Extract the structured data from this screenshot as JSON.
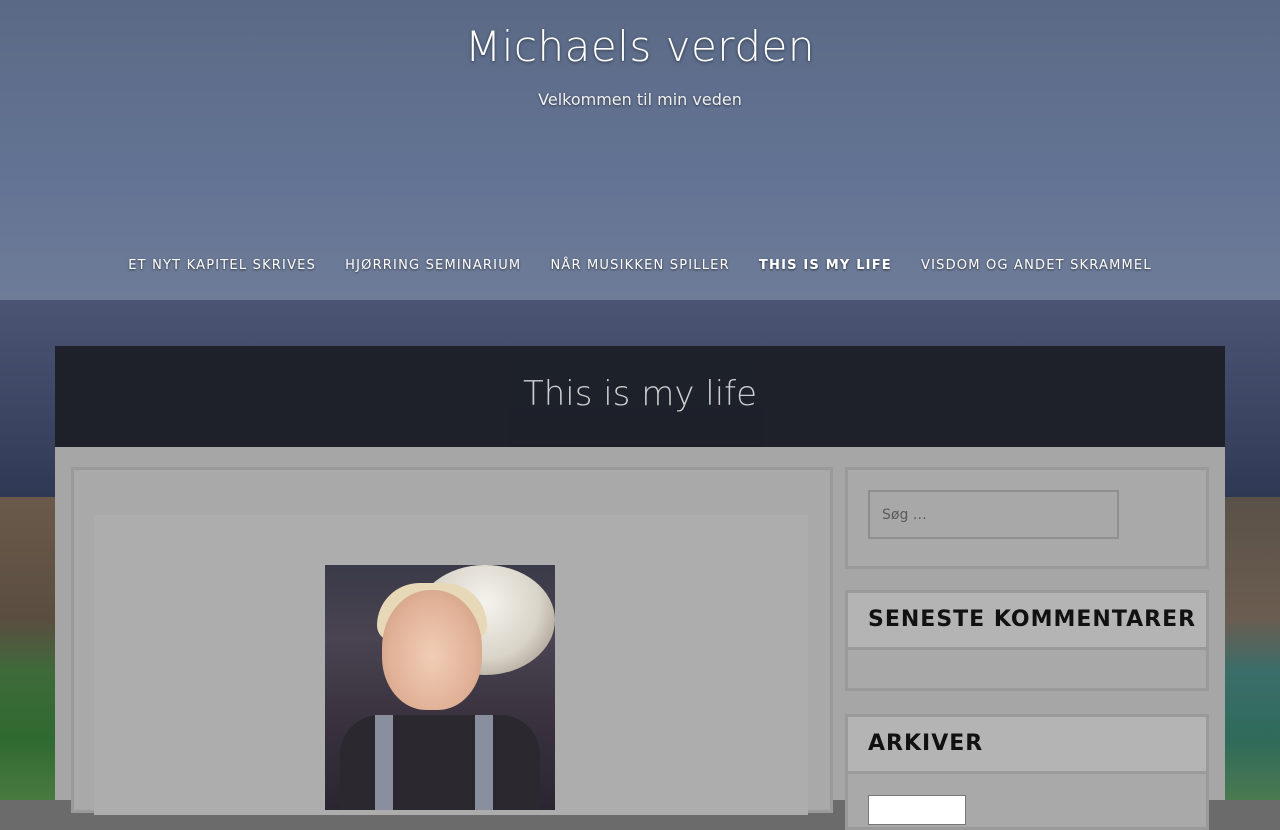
{
  "site": {
    "title": "Michaels verden",
    "description": "Velkommen til min veden"
  },
  "nav": {
    "items": [
      {
        "label": "ET NYT KAPITEL SKRIVES"
      },
      {
        "label": "HJØRRING SEMINARIUM"
      },
      {
        "label": "NÅR MUSIKKEN SPILLER"
      },
      {
        "label": "THIS IS MY LIFE",
        "active": true
      },
      {
        "label": "VISDOM OG ANDET SKRAMMEL"
      }
    ]
  },
  "page": {
    "title": "This is my life"
  },
  "sidebar": {
    "search": {
      "placeholder": "Søg …"
    },
    "recent_comments_title": "SENESTE KOMMENTARER",
    "archive_title": "ARKIVER"
  }
}
